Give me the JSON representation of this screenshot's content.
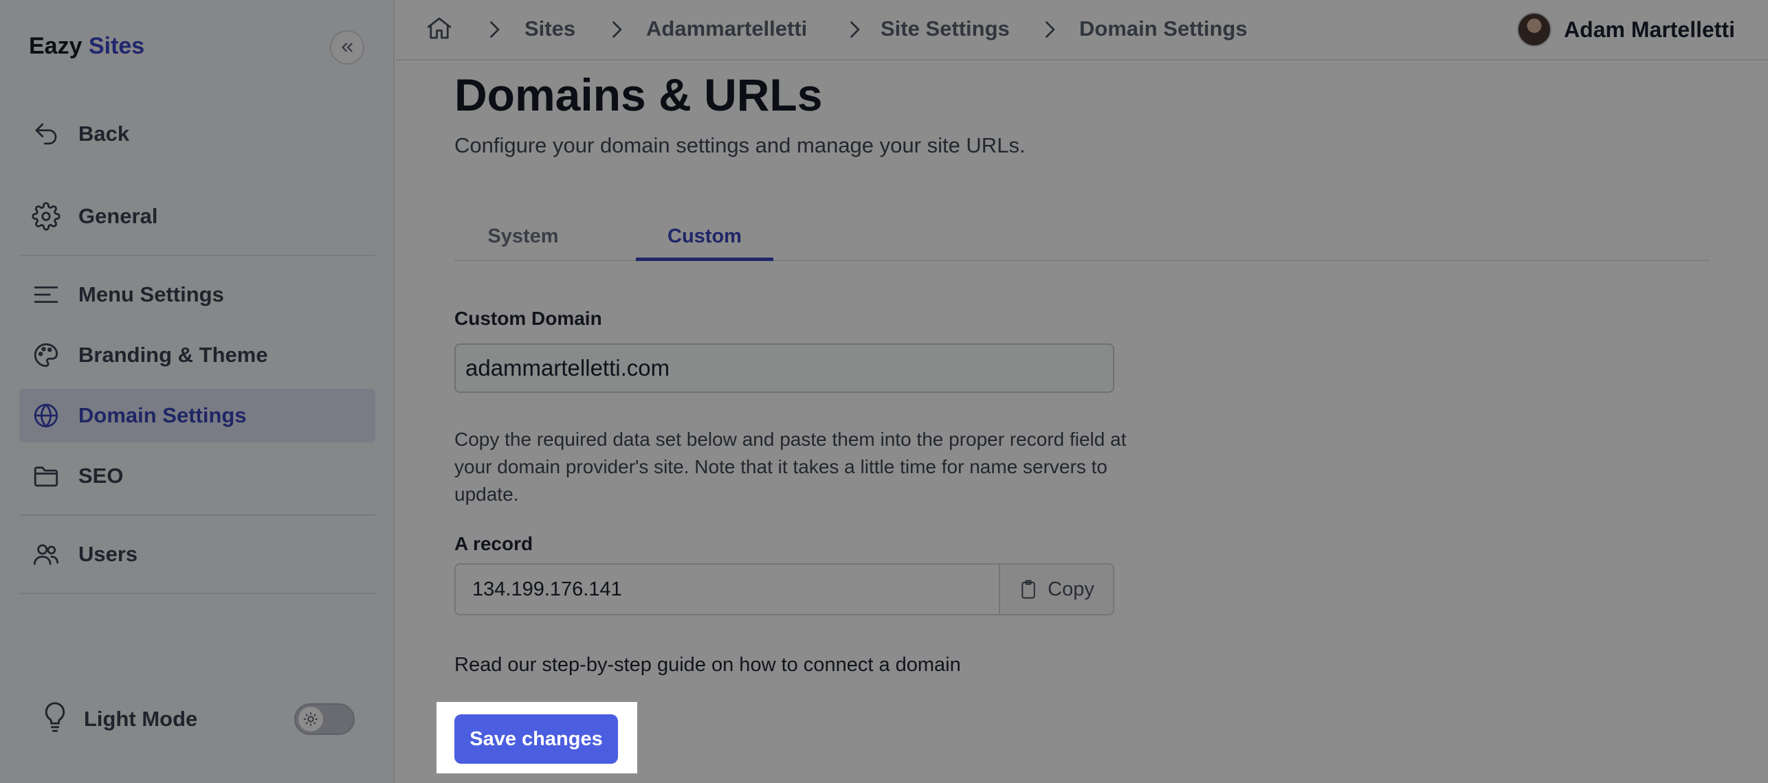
{
  "brand": {
    "name": "Eazy",
    "accent": "Sites"
  },
  "sidebar": {
    "items": [
      {
        "label": "Back",
        "icon": "back-arrow-icon"
      },
      {
        "label": "General",
        "icon": "gear-icon"
      },
      {
        "label": "Menu Settings",
        "icon": "menu-lines-icon"
      },
      {
        "label": "Branding & Theme",
        "icon": "palette-icon"
      },
      {
        "label": "Domain Settings",
        "icon": "globe-icon",
        "active": true
      },
      {
        "label": "SEO",
        "icon": "folder-icon"
      },
      {
        "label": "Users",
        "icon": "users-icon"
      }
    ],
    "light_mode_label": "Light Mode"
  },
  "breadcrumb": {
    "items": [
      "Sites",
      "Adammartelletti",
      "Site Settings",
      "Domain Settings"
    ]
  },
  "user": {
    "name": "Adam Martelletti"
  },
  "main": {
    "title": "Domains & URLs",
    "subtitle": "Configure your domain settings and manage your site URLs.",
    "tabs": [
      {
        "label": "System"
      },
      {
        "label": "Custom",
        "active": true
      }
    ],
    "custom_domain": {
      "label": "Custom Domain",
      "value": "adammartelletti.com"
    },
    "help_text": "Copy the required data set below and paste them into the proper record field at your domain provider's site. Note that it takes a little time for name servers to update.",
    "a_record": {
      "label": "A record",
      "value": "134.199.176.141",
      "copy_label": "Copy"
    },
    "guide_text": "Read our step-by-step guide on how to connect a domain",
    "save_label": "Save changes"
  },
  "colors": {
    "accent": "#3a46c0",
    "button": "#4b5ee0",
    "sidebar_bg": "#f5f6f8",
    "active_bg": "#dfe2f2"
  }
}
